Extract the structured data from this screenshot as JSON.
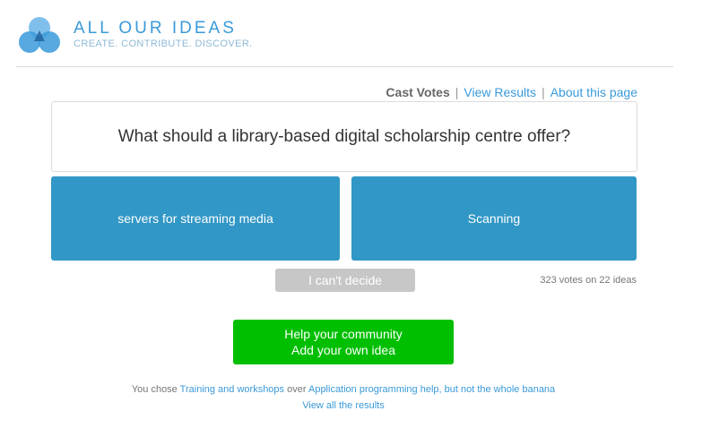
{
  "brand": {
    "title": "ALL OUR IDEAS",
    "tagline": "CREATE. CONTRIBUTE. DISCOVER.",
    "logo_icon": "three-leaf-logo-icon",
    "colors": {
      "brand_blue": "#3a9ad9",
      "leaf_light": "#6ab4e8",
      "leaf_dark": "#1e5f9a"
    }
  },
  "nav": {
    "cast_votes": "Cast Votes",
    "view_results": "View Results",
    "about": "About this page",
    "separator": "|"
  },
  "question": "What should a library-based digital scholarship centre offer?",
  "choices": {
    "left": "servers for streaming media",
    "right": "Scanning",
    "color": "#3197c6"
  },
  "cant_decide": "I can't decide",
  "vote_count": "323 votes on 22 ideas",
  "add_idea": {
    "line1": "Help your community",
    "line2": "Add your own idea",
    "color": "#00bf00"
  },
  "last_choice": {
    "prefix": "You chose",
    "winner": "Training and workshops",
    "middle": "over",
    "loser": "Application programming help, but not the whole banana"
  },
  "view_all": "View all the results"
}
